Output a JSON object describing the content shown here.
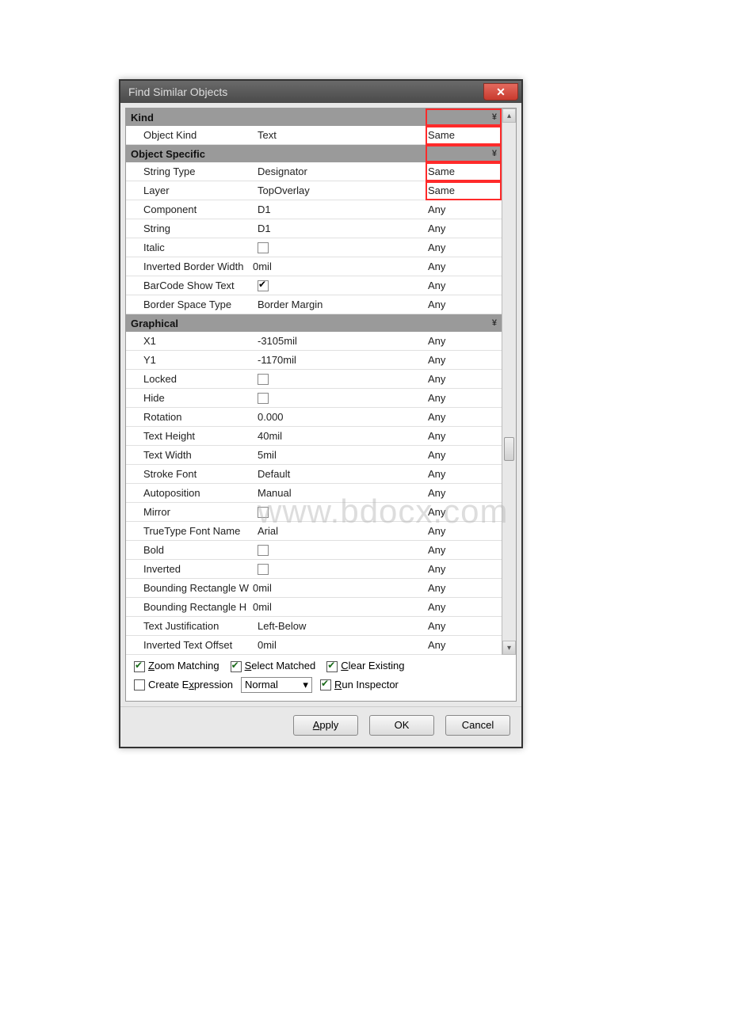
{
  "title": "Find Similar Objects",
  "sections": {
    "kind": "Kind",
    "objectSpecific": "Object Specific",
    "graphical": "Graphical"
  },
  "rows": {
    "objectKind": {
      "name": "Object Kind",
      "val": "Text",
      "match": "Same"
    },
    "stringType": {
      "name": "String Type",
      "val": "Designator",
      "match": "Same"
    },
    "layer": {
      "name": "Layer",
      "val": "TopOverlay",
      "match": "Same"
    },
    "component": {
      "name": "Component",
      "val": "D1",
      "match": "Any"
    },
    "string": {
      "name": "String",
      "val": "D1",
      "match": "Any"
    },
    "italic": {
      "name": "Italic",
      "val": "",
      "match": "Any"
    },
    "invBorderWidth": {
      "name": "Inverted Border Width",
      "val": "0mil",
      "match": "Any"
    },
    "barcodeShowText": {
      "name": "BarCode Show Text",
      "val": "",
      "match": "Any"
    },
    "borderSpaceType": {
      "name": "Border Space Type",
      "val": "Border Margin",
      "match": "Any"
    },
    "x1": {
      "name": "X1",
      "val": "-3105mil",
      "match": "Any"
    },
    "y1": {
      "name": "Y1",
      "val": "-1170mil",
      "match": "Any"
    },
    "locked": {
      "name": "Locked",
      "val": "",
      "match": "Any"
    },
    "hide": {
      "name": "Hide",
      "val": "",
      "match": "Any"
    },
    "rotation": {
      "name": "Rotation",
      "val": "0.000",
      "match": "Any"
    },
    "textHeight": {
      "name": "Text Height",
      "val": "40mil",
      "match": "Any"
    },
    "textWidth": {
      "name": "Text Width",
      "val": "5mil",
      "match": "Any"
    },
    "strokeFont": {
      "name": "Stroke Font",
      "val": "Default",
      "match": "Any"
    },
    "autoposition": {
      "name": "Autoposition",
      "val": "Manual",
      "match": "Any"
    },
    "mirror": {
      "name": "Mirror",
      "val": "",
      "match": "Any"
    },
    "ttFontName": {
      "name": "TrueType Font Name",
      "val": "Arial",
      "match": "Any"
    },
    "bold": {
      "name": "Bold",
      "val": "",
      "match": "Any"
    },
    "inverted": {
      "name": "Inverted",
      "val": "",
      "match": "Any"
    },
    "boundRectW": {
      "name": "Bounding Rectangle W",
      "val": "0mil",
      "match": "Any"
    },
    "boundRectH": {
      "name": "Bounding Rectangle H",
      "val": "0mil",
      "match": "Any"
    },
    "textJust": {
      "name": "Text Justification",
      "val": "Left-Below",
      "match": "Any"
    },
    "invTextOffset": {
      "name": "Inverted Text Offset",
      "val": "0mil",
      "match": "Any"
    }
  },
  "footer": {
    "zoomMatching": "Zoom Matching",
    "selectMatched": "Select Matched",
    "clearExisting": "Clear Existing",
    "createExpression": "Create Expression",
    "runInspector": "Run Inspector",
    "selectVal": "Normal"
  },
  "buttons": {
    "apply": "Apply",
    "ok": "OK",
    "cancel": "Cancel"
  },
  "watermark": "www.bdocx.com"
}
